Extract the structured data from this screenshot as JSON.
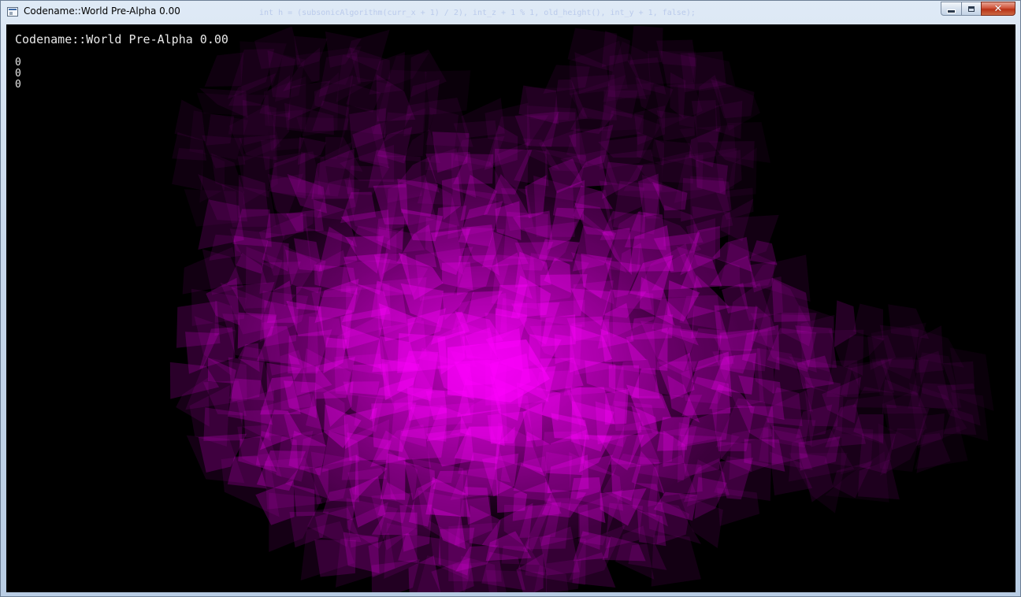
{
  "window": {
    "title": "Codename::World Pre-Alpha 0.00",
    "background_code": "int h = (subsonicAlgorithm(curr_x + 1) / 2), int_z + 1 % 1, old_height(), int_y + 1, false);",
    "controls": {
      "minimize_icon": "minimize-icon",
      "maximize_icon": "maximize-icon",
      "close_label": "✕"
    }
  },
  "hud": {
    "title": "Codename::World Pre-Alpha 0.00",
    "values": [
      "0",
      "0",
      "0"
    ]
  },
  "scene": {
    "description_icon": "terrain-mesh",
    "mesh_color": "#ff00ff",
    "background_color": "#000000"
  }
}
